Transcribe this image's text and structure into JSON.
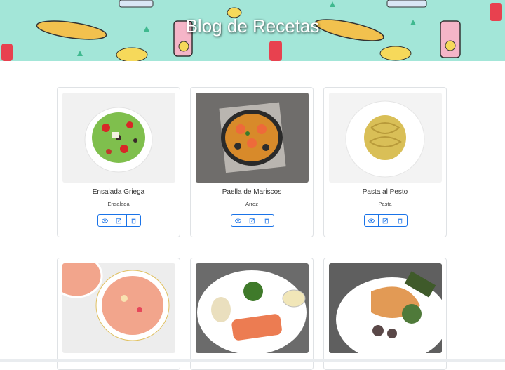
{
  "header": {
    "title": "Blog de Recetas"
  },
  "recipes": [
    {
      "title": "Ensalada Griega",
      "category": "Ensalada"
    },
    {
      "title": "Paella de Mariscos",
      "category": "Arroz"
    },
    {
      "title": "Pasta al Pesto",
      "category": "Pasta"
    },
    {
      "title": "",
      "category": ""
    },
    {
      "title": "",
      "category": ""
    },
    {
      "title": "",
      "category": ""
    }
  ],
  "icons": {
    "view": "eye-icon",
    "edit": "edit-icon",
    "delete": "trash-icon"
  },
  "colors": {
    "banner": "#a3e6d8",
    "accent": "#1a73e8"
  }
}
